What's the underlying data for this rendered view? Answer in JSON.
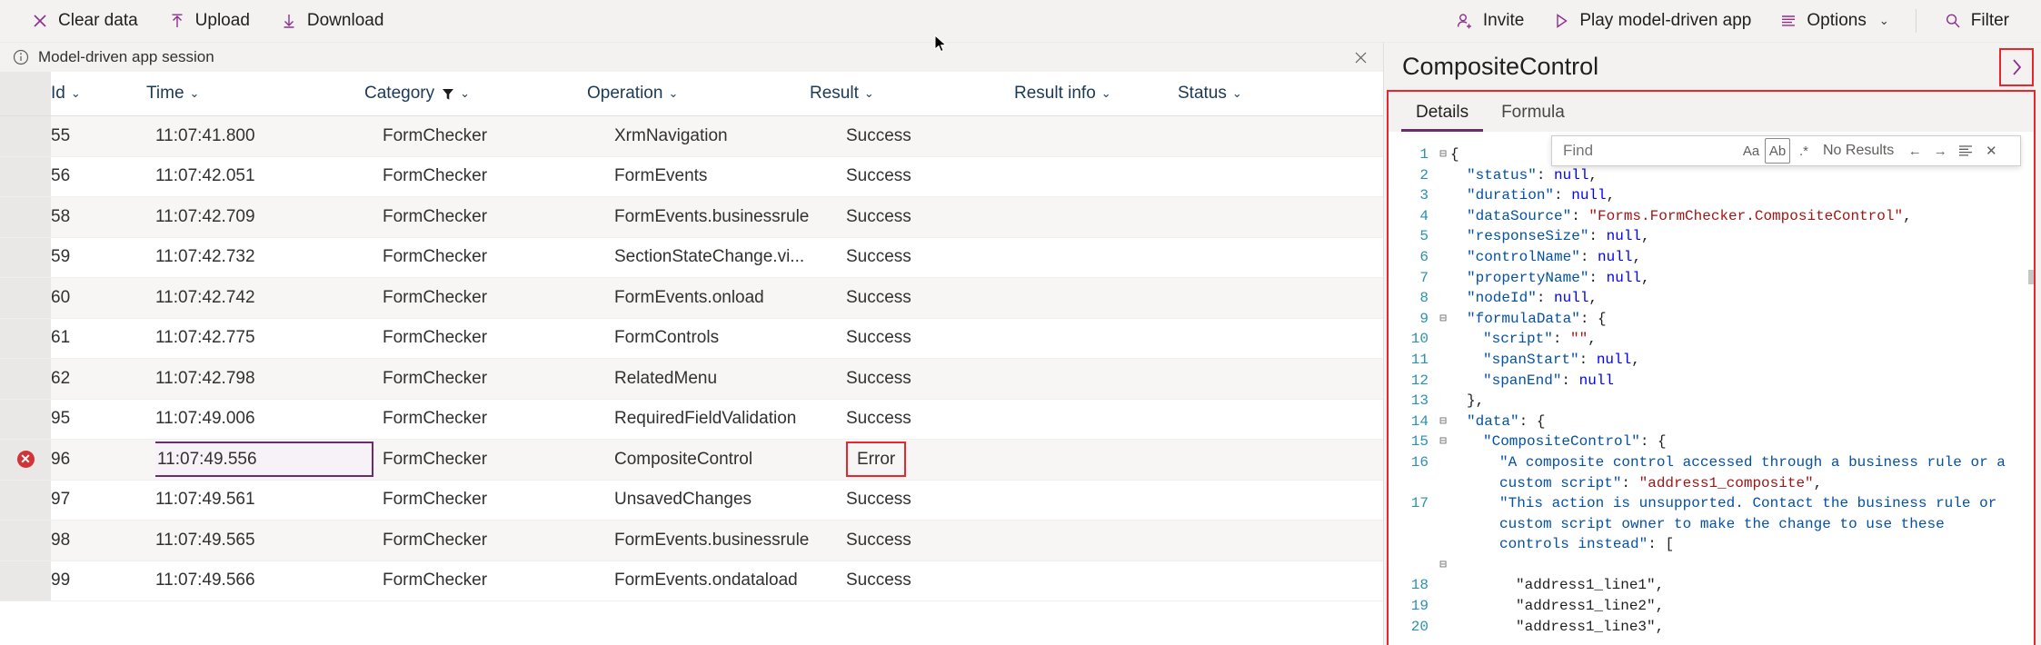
{
  "toolbar": {
    "left_items": [
      {
        "label": "Clear data",
        "icon": "close-x-icon"
      },
      {
        "label": "Upload",
        "icon": "upload-arrow-icon"
      },
      {
        "label": "Download",
        "icon": "download-arrow-icon"
      }
    ],
    "right_items": [
      {
        "label": "Invite",
        "icon": "person-add-icon",
        "caret": ""
      },
      {
        "label": "Play model-driven app",
        "icon": "play-triangle-icon",
        "caret": ""
      },
      {
        "label": "Options",
        "icon": "list-lines-icon",
        "caret": "⌄"
      },
      {
        "label": "Filter",
        "icon": "search-magnifier-icon",
        "caret": ""
      }
    ]
  },
  "session": {
    "label": "Model-driven app session",
    "info_icon": "info-circle-icon",
    "close_icon": "close-x-icon"
  },
  "grid": {
    "columns": [
      {
        "key": "id",
        "label": "Id",
        "filtered": false
      },
      {
        "key": "time",
        "label": "Time",
        "filtered": false
      },
      {
        "key": "category",
        "label": "Category",
        "filtered": true
      },
      {
        "key": "operation",
        "label": "Operation",
        "filtered": false
      },
      {
        "key": "result",
        "label": "Result",
        "filtered": false
      },
      {
        "key": "result_info",
        "label": "Result info",
        "filtered": false
      },
      {
        "key": "status",
        "label": "Status",
        "filtered": false
      }
    ],
    "rows": [
      {
        "id": "55",
        "time": "11:07:41.800",
        "category": "FormChecker",
        "operation": "XrmNavigation",
        "result": "Success",
        "result_info": "",
        "status": "",
        "error": false,
        "selected": false
      },
      {
        "id": "56",
        "time": "11:07:42.051",
        "category": "FormChecker",
        "operation": "FormEvents",
        "result": "Success",
        "result_info": "",
        "status": "",
        "error": false,
        "selected": false
      },
      {
        "id": "58",
        "time": "11:07:42.709",
        "category": "FormChecker",
        "operation": "FormEvents.businessrule",
        "result": "Success",
        "result_info": "",
        "status": "",
        "error": false,
        "selected": false
      },
      {
        "id": "59",
        "time": "11:07:42.732",
        "category": "FormChecker",
        "operation": "SectionStateChange.vi...",
        "result": "Success",
        "result_info": "",
        "status": "",
        "error": false,
        "selected": false
      },
      {
        "id": "60",
        "time": "11:07:42.742",
        "category": "FormChecker",
        "operation": "FormEvents.onload",
        "result": "Success",
        "result_info": "",
        "status": "",
        "error": false,
        "selected": false
      },
      {
        "id": "61",
        "time": "11:07:42.775",
        "category": "FormChecker",
        "operation": "FormControls",
        "result": "Success",
        "result_info": "",
        "status": "",
        "error": false,
        "selected": false
      },
      {
        "id": "62",
        "time": "11:07:42.798",
        "category": "FormChecker",
        "operation": "RelatedMenu",
        "result": "Success",
        "result_info": "",
        "status": "",
        "error": false,
        "selected": false
      },
      {
        "id": "95",
        "time": "11:07:49.006",
        "category": "FormChecker",
        "operation": "RequiredFieldValidation",
        "result": "Success",
        "result_info": "",
        "status": "",
        "error": false,
        "selected": false
      },
      {
        "id": "96",
        "time": "11:07:49.556",
        "category": "FormChecker",
        "operation": "CompositeControl",
        "result": "Error",
        "result_info": "",
        "status": "",
        "error": true,
        "selected": true
      },
      {
        "id": "97",
        "time": "11:07:49.561",
        "category": "FormChecker",
        "operation": "UnsavedChanges",
        "result": "Success",
        "result_info": "",
        "status": "",
        "error": false,
        "selected": false
      },
      {
        "id": "98",
        "time": "11:07:49.565",
        "category": "FormChecker",
        "operation": "FormEvents.businessrule",
        "result": "Success",
        "result_info": "",
        "status": "",
        "error": false,
        "selected": false
      },
      {
        "id": "99",
        "time": "11:07:49.566",
        "category": "FormChecker",
        "operation": "FormEvents.ondataload",
        "result": "Success",
        "result_info": "",
        "status": "",
        "error": false,
        "selected": false
      }
    ]
  },
  "details_panel": {
    "title": "CompositeControl",
    "expand_icon": "chevron-right-icon",
    "tabs": [
      {
        "label": "Details",
        "active": true
      },
      {
        "label": "Formula",
        "active": false
      }
    ],
    "find": {
      "placeholder": "Find",
      "value": "",
      "match_case_icon": "Aa",
      "match_word_icon": "Ab",
      "regex_icon": ".*",
      "status": "No Results",
      "prev_icon": "←",
      "next_icon": "→",
      "find_in_selection_icon": "selection-icon",
      "close_icon": "✕"
    },
    "code_lines": [
      {
        "n": "1",
        "fold": "⊟",
        "indent": 0,
        "text": "{"
      },
      {
        "n": "2",
        "fold": "",
        "indent": 1,
        "text": "\"status\": null,"
      },
      {
        "n": "3",
        "fold": "",
        "indent": 1,
        "text": "\"duration\": null,"
      },
      {
        "n": "4",
        "fold": "",
        "indent": 1,
        "text": "\"dataSource\": \"Forms.FormChecker.CompositeControl\","
      },
      {
        "n": "5",
        "fold": "",
        "indent": 1,
        "text": "\"responseSize\": null,"
      },
      {
        "n": "6",
        "fold": "",
        "indent": 1,
        "text": "\"controlName\": null,"
      },
      {
        "n": "7",
        "fold": "",
        "indent": 1,
        "text": "\"propertyName\": null,"
      },
      {
        "n": "8",
        "fold": "",
        "indent": 1,
        "text": "\"nodeId\": null,"
      },
      {
        "n": "9",
        "fold": "⊟",
        "indent": 1,
        "text": "\"formulaData\": {"
      },
      {
        "n": "10",
        "fold": "",
        "indent": 2,
        "text": "\"script\": \"\","
      },
      {
        "n": "11",
        "fold": "",
        "indent": 2,
        "text": "\"spanStart\": null,"
      },
      {
        "n": "12",
        "fold": "",
        "indent": 2,
        "text": "\"spanEnd\": null"
      },
      {
        "n": "13",
        "fold": "",
        "indent": 1,
        "text": "},"
      },
      {
        "n": "14",
        "fold": "⊟",
        "indent": 1,
        "text": "\"data\": {"
      },
      {
        "n": "15",
        "fold": "⊟",
        "indent": 2,
        "text": "\"CompositeControl\": {"
      },
      {
        "n": "16",
        "fold": "",
        "indent": 3,
        "text": "\"A composite control accessed through a business rule or a custom script\": \"address1_composite\","
      },
      {
        "n": "17",
        "fold": "",
        "indent": 3,
        "text": "\"This action is unsupported. Contact the business rule or custom script owner to make the change to use these controls instead\": ["
      },
      {
        "n": "",
        "fold": "⊟",
        "indent": 3,
        "text": ""
      },
      {
        "n": "18",
        "fold": "",
        "indent": 4,
        "text": "\"address1_line1\","
      },
      {
        "n": "19",
        "fold": "",
        "indent": 4,
        "text": "\"address1_line2\","
      },
      {
        "n": "20",
        "fold": "",
        "indent": 4,
        "text": "\"address1_line3\","
      }
    ]
  },
  "colors": {
    "accent_purple": "#8e2f8e",
    "highlight_red": "#e8262d",
    "error_red": "#d13438",
    "tab_underline": "#6b2c6b",
    "code_keyword": "#0451a5",
    "code_string": "#a31515",
    "code_null": "#0000ff",
    "line_number": "#2b91af"
  }
}
